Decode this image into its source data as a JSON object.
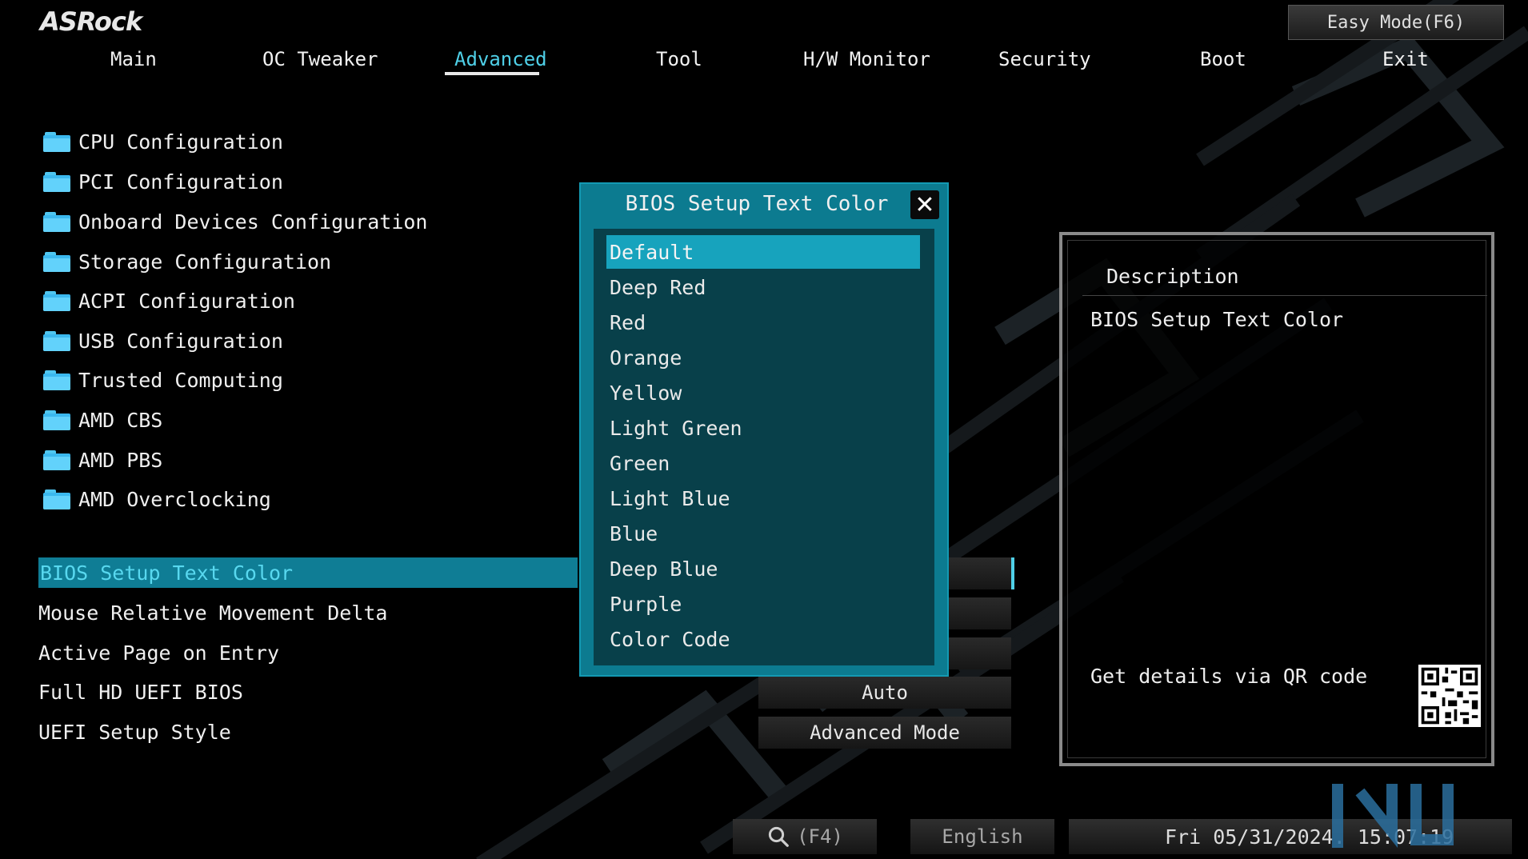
{
  "brand": {
    "logo_text": "ASRock"
  },
  "header": {
    "easy_mode_label": "Easy Mode(F6)"
  },
  "nav": {
    "tabs": [
      "Main",
      "OC Tweaker",
      "Advanced",
      "Tool",
      "H/W Monitor",
      "Security",
      "Boot",
      "Exit"
    ],
    "active": "Advanced"
  },
  "menu": {
    "items": [
      "CPU Configuration",
      "PCI Configuration",
      "Onboard Devices Configuration",
      "Storage Configuration",
      "ACPI Configuration",
      "USB Configuration",
      "Trusted Computing",
      "AMD CBS",
      "AMD PBS",
      "AMD Overclocking"
    ]
  },
  "settings": {
    "rows": [
      {
        "label": "BIOS Setup Text Color",
        "value": ""
      },
      {
        "label": "Mouse Relative Movement Delta",
        "value": ""
      },
      {
        "label": "Active Page on Entry",
        "value": ""
      },
      {
        "label": "Full HD UEFI BIOS",
        "value": "Auto"
      },
      {
        "label": "UEFI Setup Style",
        "value": "Advanced Mode"
      }
    ]
  },
  "dialog": {
    "title": "BIOS Setup Text Color",
    "options": [
      "Default",
      "Deep Red",
      "Red",
      "Orange",
      "Yellow",
      "Light Green",
      "Green",
      "Light Blue",
      "Blue",
      "Deep Blue",
      "Purple",
      "Color Code"
    ],
    "selected": "Default"
  },
  "description": {
    "header": "Description",
    "text": "BIOS Setup Text Color",
    "qr_text": "Get details via QR code"
  },
  "bottom": {
    "search_key": "(F4)",
    "language": "English",
    "datetime": "Fri 05/31/2024. 15:07:19"
  },
  "colors": {
    "accent": "#4fd0e8",
    "selection": "#0f7d95",
    "dialog_bg": "#0c7b90",
    "list_bg": "#08404a",
    "folder": "#3bb8ee"
  }
}
